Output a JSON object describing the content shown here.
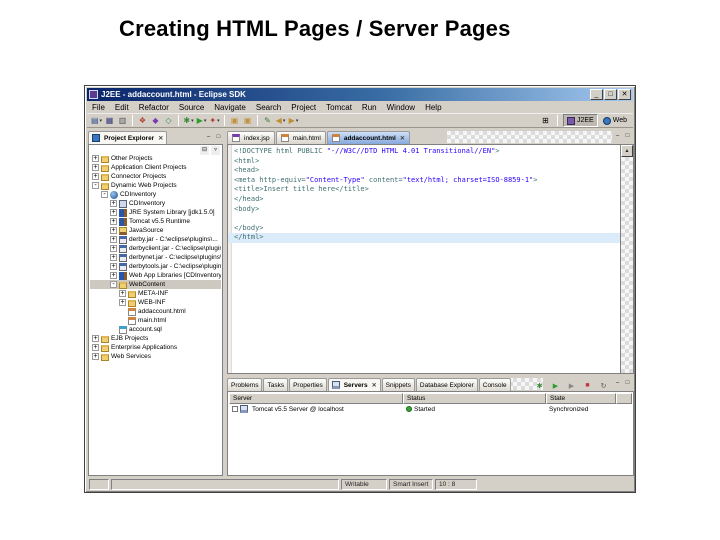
{
  "slide": {
    "title": "Creating HTML Pages / Server Pages"
  },
  "window": {
    "title": "J2EE - addaccount.html - Eclipse SDK",
    "controls": [
      {
        "name": "minimize-button",
        "glyph": "_"
      },
      {
        "name": "maximize-button",
        "glyph": "□"
      },
      {
        "name": "close-button",
        "glyph": "✕"
      }
    ],
    "menu": [
      "File",
      "Edit",
      "Refactor",
      "Source",
      "Navigate",
      "Search",
      "Project",
      "Tomcat",
      "Run",
      "Window",
      "Help"
    ],
    "toolbar": [
      {
        "name": "new-wizard",
        "glyph": "▤",
        "color": "#2b4d8c",
        "dropdown": true
      },
      {
        "name": "save",
        "glyph": "▦",
        "color": "#3a3a7a"
      },
      {
        "name": "print",
        "glyph": "▥",
        "color": "#555555"
      },
      {
        "sep": true
      },
      {
        "name": "new-web-project",
        "glyph": "❖",
        "color": "#b23b2e"
      },
      {
        "name": "new-servlet",
        "glyph": "◆",
        "color": "#7a3bb2"
      },
      {
        "name": "new-jsp",
        "glyph": "◇",
        "color": "#2e8b57"
      },
      {
        "sep": true
      },
      {
        "name": "debug",
        "glyph": "✱",
        "color": "#3a8a3a",
        "dropdown": true
      },
      {
        "name": "run",
        "glyph": "▶",
        "color": "#2e9e2e",
        "dropdown": true
      },
      {
        "name": "external-tools",
        "glyph": "✦",
        "color": "#b23b2e",
        "dropdown": true
      },
      {
        "sep": true
      },
      {
        "name": "import",
        "glyph": "▣",
        "color": "#c09038"
      },
      {
        "name": "export",
        "glyph": "▣",
        "color": "#c09038"
      },
      {
        "sep": true
      },
      {
        "name": "last-edit-location",
        "glyph": "✎",
        "color": "#3a7a3a"
      },
      {
        "name": "back",
        "glyph": "◀",
        "color": "#c09038",
        "dropdown": true
      },
      {
        "name": "forward",
        "glyph": "▶",
        "color": "#c09038",
        "dropdown": true
      }
    ],
    "open_perspective_glyph": "⊞",
    "perspectives": [
      {
        "label": "J2EE",
        "active": true
      },
      {
        "label": "Web",
        "active": false
      }
    ],
    "view_controls": {
      "minimize": "–",
      "maximize": "□"
    }
  },
  "explorer": {
    "tab_label": "Project Explorer",
    "close_glyph": "✕",
    "toolbar": [
      {
        "name": "collapse-all",
        "glyph": "⊟"
      },
      {
        "name": "view-menu",
        "glyph": "▿"
      }
    ],
    "items": [
      {
        "label": "Other Projects",
        "depth": 0,
        "expander": "+",
        "icon": "folder"
      },
      {
        "label": "Application Client Projects",
        "depth": 0,
        "expander": "+",
        "icon": "folder"
      },
      {
        "label": "Connector Projects",
        "depth": 0,
        "expander": "+",
        "icon": "folder"
      },
      {
        "label": "Dynamic Web Projects",
        "depth": 0,
        "expander": "-",
        "icon": "folder"
      },
      {
        "label": "CDInventory",
        "depth": 1,
        "expander": "-",
        "icon": "webproj"
      },
      {
        "label": "CDInventory",
        "depth": 2,
        "expander": "+",
        "icon": "descriptor"
      },
      {
        "label": "JRE System Library [jdk1.5.0]",
        "depth": 2,
        "expander": "+",
        "icon": "lib"
      },
      {
        "label": "Tomcat v5.5 Runtime",
        "depth": 2,
        "expander": "+",
        "icon": "lib"
      },
      {
        "label": "JavaSource",
        "depth": 2,
        "expander": "+",
        "icon": "pkgfolder"
      },
      {
        "label": "derby.jar - C:\\eclipse\\plugins\\...",
        "depth": 2,
        "expander": "+",
        "icon": "jar"
      },
      {
        "label": "derbyclient.jar - C:\\eclipse\\plugins\\...",
        "depth": 2,
        "expander": "+",
        "icon": "jar"
      },
      {
        "label": "derbynet.jar - C:\\eclipse\\plugins\\...",
        "depth": 2,
        "expander": "+",
        "icon": "jar"
      },
      {
        "label": "derbytools.jar - C:\\eclipse\\plugins\\...",
        "depth": 2,
        "expander": "+",
        "icon": "jar"
      },
      {
        "label": "Web App Libraries [CDInventory]",
        "depth": 2,
        "expander": "+",
        "icon": "lib"
      },
      {
        "label": "WebContent",
        "depth": 2,
        "expander": "-",
        "icon": "folder",
        "selected": true
      },
      {
        "label": "META-INF",
        "depth": 3,
        "expander": "+",
        "icon": "folder"
      },
      {
        "label": "WEB-INF",
        "depth": 3,
        "expander": "+",
        "icon": "folder"
      },
      {
        "label": "addaccount.html",
        "depth": 3,
        "expander": "",
        "icon": "html"
      },
      {
        "label": "main.html",
        "depth": 3,
        "expander": "",
        "icon": "html"
      },
      {
        "label": "account.sql",
        "depth": 2,
        "expander": "",
        "icon": "sql"
      },
      {
        "label": "EJB Projects",
        "depth": 0,
        "expander": "+",
        "icon": "folder"
      },
      {
        "label": "Enterprise Applications",
        "depth": 0,
        "expander": "+",
        "icon": "folder"
      },
      {
        "label": "Web Services",
        "depth": 0,
        "expander": "+",
        "icon": "folder"
      }
    ]
  },
  "editor": {
    "tabs": [
      {
        "label": "index.jsp",
        "icon": "jspfile",
        "active": false
      },
      {
        "label": "main.html",
        "icon": "html",
        "active": false
      },
      {
        "label": "addaccount.html",
        "icon": "html",
        "active": true
      }
    ],
    "close_glyph": "✕",
    "scroll_up_glyph": "▲",
    "cursor_line": 9,
    "code": [
      "<!DOCTYPE html PUBLIC \"-//W3C//DTD HTML 4.01 Transitional//EN\">",
      "<html>",
      "<head>",
      "<meta http-equiv=\"Content-Type\" content=\"text/html; charset=ISO-8859-1\">",
      "<title>Insert title here</title>",
      "</head>",
      "<body>",
      "",
      "</body>",
      "</html>"
    ]
  },
  "servers": {
    "tabs": [
      {
        "label": "Problems",
        "active": false
      },
      {
        "label": "Tasks",
        "active": false
      },
      {
        "label": "Properties",
        "active": false
      },
      {
        "label": "Servers",
        "active": true
      },
      {
        "label": "Snippets",
        "active": false
      },
      {
        "label": "Database Explorer",
        "active": false
      },
      {
        "label": "Console",
        "active": false
      }
    ],
    "toolbar": [
      {
        "name": "debug-server",
        "glyph": "✱",
        "color": "#3a8a3a"
      },
      {
        "name": "start-server",
        "glyph": "▶",
        "color": "#2e9e2e"
      },
      {
        "name": "profile-server",
        "glyph": "▶",
        "color": "#888888"
      },
      {
        "name": "stop-server",
        "glyph": "■",
        "color": "#c03a3a"
      },
      {
        "name": "publish-server",
        "glyph": "↻",
        "color": "#555555"
      }
    ],
    "columns": [
      "Server",
      "Status",
      "State"
    ],
    "rows": [
      {
        "server": "Tomcat v5.5 Server @ localhost",
        "status": "Started",
        "state": "Synchronized"
      }
    ]
  },
  "statusbar": {
    "writable": "Writable",
    "insert_mode": "Smart Insert",
    "position": "10 : 8"
  }
}
